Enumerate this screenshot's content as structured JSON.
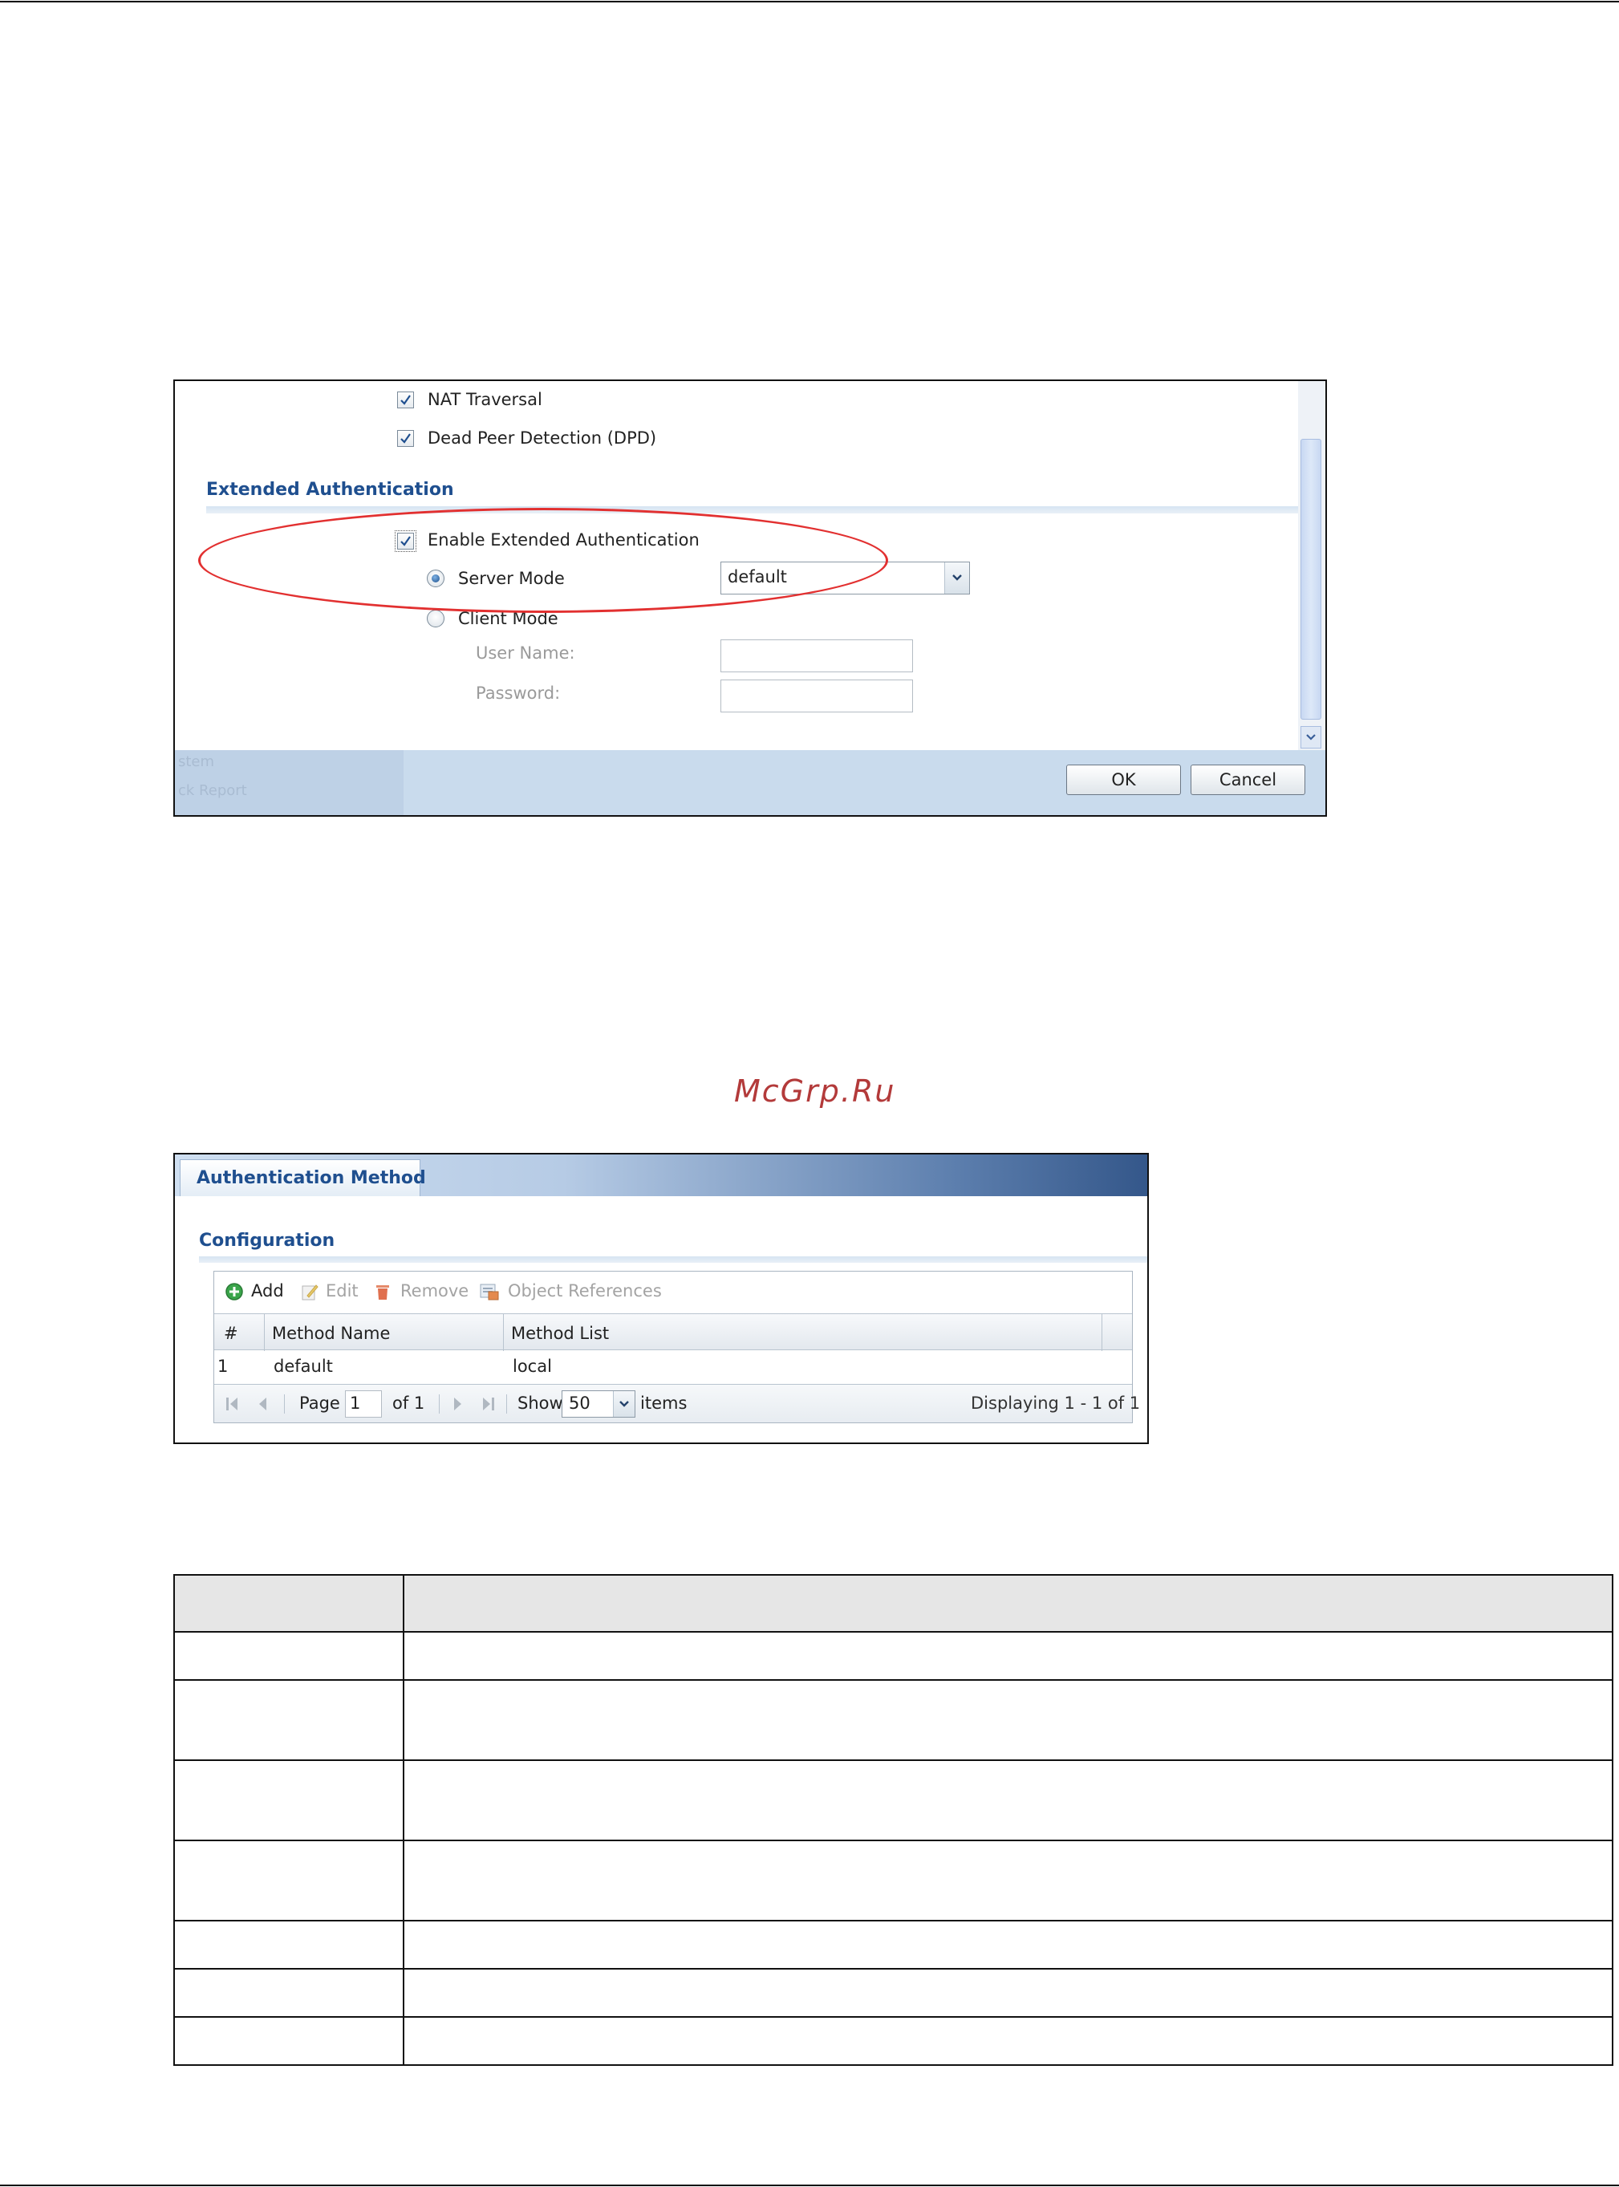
{
  "fig1": {
    "nat_traversal": "NAT Traversal",
    "dpd": "Dead Peer Detection (DPD)",
    "section_title": "Extended Authentication",
    "enable_xauth": "Enable Extended Authentication",
    "server_mode": "Server Mode",
    "server_mode_value": "default",
    "client_mode": "Client Mode",
    "user_name_label": "User Name:",
    "password_label": "Password:",
    "ghost_text_1": "stem",
    "ghost_text_2": "ck Report",
    "ok_label": "OK",
    "cancel_label": "Cancel"
  },
  "watermark": "McGrp.Ru",
  "fig2": {
    "tab_label": "Authentication Method",
    "section_title": "Configuration",
    "toolbar": {
      "add": "Add",
      "edit": "Edit",
      "remove": "Remove",
      "object_references": "Object References"
    },
    "columns": [
      "#",
      "Method Name",
      "Method List"
    ],
    "rows": [
      {
        "index": "1",
        "method_name": "default",
        "method_list": "local"
      }
    ],
    "pager": {
      "page_label": "Page",
      "page_value": "1",
      "of_label": "of 1",
      "show_label": "Show",
      "show_value": "50",
      "items_label": "items",
      "displaying": "Displaying 1 - 1 of 1"
    }
  },
  "colors": {
    "accent_blue": "#1f4f8f",
    "highlight_red": "#e23030",
    "footer_blue": "#c9dbed"
  }
}
